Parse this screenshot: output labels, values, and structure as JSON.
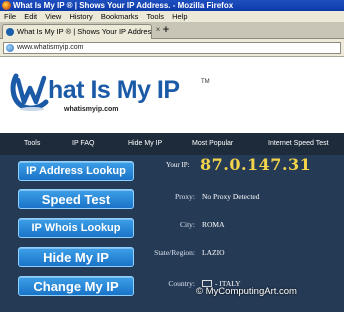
{
  "window": {
    "title": "What Is My IP ® | Shows Your IP Address. - Mozilla Firefox"
  },
  "menu": {
    "items": [
      "File",
      "Edit",
      "View",
      "History",
      "Bookmarks",
      "Tools",
      "Help"
    ]
  },
  "tab": {
    "label": "What Is My IP ® | Shows Your IP Address...",
    "new_tab": "+",
    "close": "×"
  },
  "address_bar": {
    "url": "www.whatismyip.com"
  },
  "logo": {
    "text": "hat Is My IP",
    "tm": "TM",
    "subtitle": "whatismyip.com"
  },
  "nav": {
    "items": [
      "Tools",
      "IP FAQ",
      "Hide My IP",
      "Most Popular",
      "Internet Speed Test"
    ]
  },
  "buttons": [
    "IP Address Lookup",
    "Speed Test",
    "IP Whois Lookup",
    "Hide My IP",
    "Change My IP"
  ],
  "ip": {
    "label": "Your IP:",
    "value": "87.0.147.31"
  },
  "details": [
    {
      "label": "Proxy:",
      "value": "No Proxy Detected"
    },
    {
      "label": "City:",
      "value": "ROMA"
    },
    {
      "label": "State/Region:",
      "value": "LAZIO"
    },
    {
      "label": "Country:",
      "value": "- ITALY"
    }
  ],
  "flag_colors": [
    "#009246",
    "#ffffff",
    "#ce2b37"
  ],
  "watermark": "© MyComputingArt.com",
  "colors": {
    "nav_bg": "#1e2b3b",
    "content_bg": "#253a55",
    "button_bg": "#1a73c8",
    "ip_color": "#f3d34a",
    "logo_blue": "#1a5aa6"
  }
}
